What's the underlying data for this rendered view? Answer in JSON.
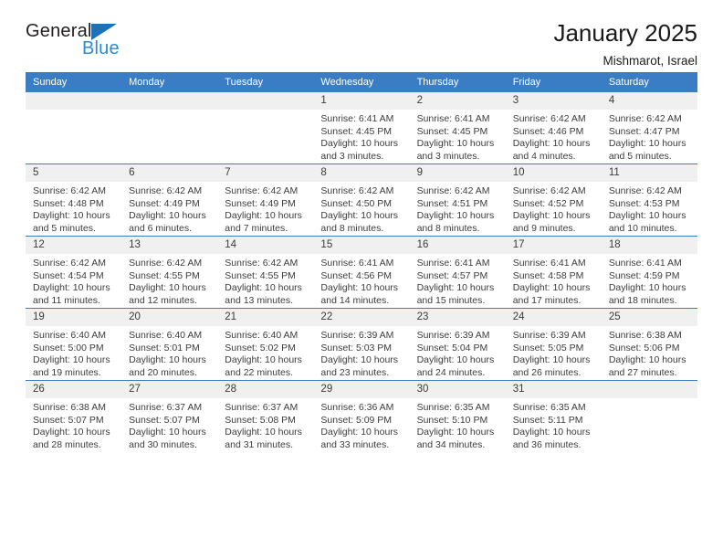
{
  "brand": {
    "name_top": "General",
    "name_bottom": "Blue",
    "accent_color": "#2e8ad4",
    "triangle_color": "#1d71b8"
  },
  "header": {
    "title": "January 2025",
    "subtitle": "Mishmarot, Israel"
  },
  "calendar": {
    "header_bg": "#3b7dc4",
    "daynum_bg": "#f0f0f0",
    "weekdays": [
      "Sunday",
      "Monday",
      "Tuesday",
      "Wednesday",
      "Thursday",
      "Friday",
      "Saturday"
    ],
    "labels": {
      "sunrise": "Sunrise:",
      "sunset": "Sunset:",
      "daylight": "Daylight:"
    },
    "weeks": [
      [
        {
          "day": "",
          "empty": true
        },
        {
          "day": "",
          "empty": true
        },
        {
          "day": "",
          "empty": true
        },
        {
          "day": "1",
          "sunrise": "Sunrise: 6:41 AM",
          "sunset": "Sunset: 4:45 PM",
          "daylight": "Daylight: 10 hours and 3 minutes."
        },
        {
          "day": "2",
          "sunrise": "Sunrise: 6:41 AM",
          "sunset": "Sunset: 4:45 PM",
          "daylight": "Daylight: 10 hours and 3 minutes."
        },
        {
          "day": "3",
          "sunrise": "Sunrise: 6:42 AM",
          "sunset": "Sunset: 4:46 PM",
          "daylight": "Daylight: 10 hours and 4 minutes."
        },
        {
          "day": "4",
          "sunrise": "Sunrise: 6:42 AM",
          "sunset": "Sunset: 4:47 PM",
          "daylight": "Daylight: 10 hours and 5 minutes."
        }
      ],
      [
        {
          "day": "5",
          "sunrise": "Sunrise: 6:42 AM",
          "sunset": "Sunset: 4:48 PM",
          "daylight": "Daylight: 10 hours and 5 minutes."
        },
        {
          "day": "6",
          "sunrise": "Sunrise: 6:42 AM",
          "sunset": "Sunset: 4:49 PM",
          "daylight": "Daylight: 10 hours and 6 minutes."
        },
        {
          "day": "7",
          "sunrise": "Sunrise: 6:42 AM",
          "sunset": "Sunset: 4:49 PM",
          "daylight": "Daylight: 10 hours and 7 minutes."
        },
        {
          "day": "8",
          "sunrise": "Sunrise: 6:42 AM",
          "sunset": "Sunset: 4:50 PM",
          "daylight": "Daylight: 10 hours and 8 minutes."
        },
        {
          "day": "9",
          "sunrise": "Sunrise: 6:42 AM",
          "sunset": "Sunset: 4:51 PM",
          "daylight": "Daylight: 10 hours and 8 minutes."
        },
        {
          "day": "10",
          "sunrise": "Sunrise: 6:42 AM",
          "sunset": "Sunset: 4:52 PM",
          "daylight": "Daylight: 10 hours and 9 minutes."
        },
        {
          "day": "11",
          "sunrise": "Sunrise: 6:42 AM",
          "sunset": "Sunset: 4:53 PM",
          "daylight": "Daylight: 10 hours and 10 minutes."
        }
      ],
      [
        {
          "day": "12",
          "sunrise": "Sunrise: 6:42 AM",
          "sunset": "Sunset: 4:54 PM",
          "daylight": "Daylight: 10 hours and 11 minutes."
        },
        {
          "day": "13",
          "sunrise": "Sunrise: 6:42 AM",
          "sunset": "Sunset: 4:55 PM",
          "daylight": "Daylight: 10 hours and 12 minutes."
        },
        {
          "day": "14",
          "sunrise": "Sunrise: 6:42 AM",
          "sunset": "Sunset: 4:55 PM",
          "daylight": "Daylight: 10 hours and 13 minutes."
        },
        {
          "day": "15",
          "sunrise": "Sunrise: 6:41 AM",
          "sunset": "Sunset: 4:56 PM",
          "daylight": "Daylight: 10 hours and 14 minutes."
        },
        {
          "day": "16",
          "sunrise": "Sunrise: 6:41 AM",
          "sunset": "Sunset: 4:57 PM",
          "daylight": "Daylight: 10 hours and 15 minutes."
        },
        {
          "day": "17",
          "sunrise": "Sunrise: 6:41 AM",
          "sunset": "Sunset: 4:58 PM",
          "daylight": "Daylight: 10 hours and 17 minutes."
        },
        {
          "day": "18",
          "sunrise": "Sunrise: 6:41 AM",
          "sunset": "Sunset: 4:59 PM",
          "daylight": "Daylight: 10 hours and 18 minutes."
        }
      ],
      [
        {
          "day": "19",
          "sunrise": "Sunrise: 6:40 AM",
          "sunset": "Sunset: 5:00 PM",
          "daylight": "Daylight: 10 hours and 19 minutes."
        },
        {
          "day": "20",
          "sunrise": "Sunrise: 6:40 AM",
          "sunset": "Sunset: 5:01 PM",
          "daylight": "Daylight: 10 hours and 20 minutes."
        },
        {
          "day": "21",
          "sunrise": "Sunrise: 6:40 AM",
          "sunset": "Sunset: 5:02 PM",
          "daylight": "Daylight: 10 hours and 22 minutes."
        },
        {
          "day": "22",
          "sunrise": "Sunrise: 6:39 AM",
          "sunset": "Sunset: 5:03 PM",
          "daylight": "Daylight: 10 hours and 23 minutes."
        },
        {
          "day": "23",
          "sunrise": "Sunrise: 6:39 AM",
          "sunset": "Sunset: 5:04 PM",
          "daylight": "Daylight: 10 hours and 24 minutes."
        },
        {
          "day": "24",
          "sunrise": "Sunrise: 6:39 AM",
          "sunset": "Sunset: 5:05 PM",
          "daylight": "Daylight: 10 hours and 26 minutes."
        },
        {
          "day": "25",
          "sunrise": "Sunrise: 6:38 AM",
          "sunset": "Sunset: 5:06 PM",
          "daylight": "Daylight: 10 hours and 27 minutes."
        }
      ],
      [
        {
          "day": "26",
          "sunrise": "Sunrise: 6:38 AM",
          "sunset": "Sunset: 5:07 PM",
          "daylight": "Daylight: 10 hours and 28 minutes."
        },
        {
          "day": "27",
          "sunrise": "Sunrise: 6:37 AM",
          "sunset": "Sunset: 5:07 PM",
          "daylight": "Daylight: 10 hours and 30 minutes."
        },
        {
          "day": "28",
          "sunrise": "Sunrise: 6:37 AM",
          "sunset": "Sunset: 5:08 PM",
          "daylight": "Daylight: 10 hours and 31 minutes."
        },
        {
          "day": "29",
          "sunrise": "Sunrise: 6:36 AM",
          "sunset": "Sunset: 5:09 PM",
          "daylight": "Daylight: 10 hours and 33 minutes."
        },
        {
          "day": "30",
          "sunrise": "Sunrise: 6:35 AM",
          "sunset": "Sunset: 5:10 PM",
          "daylight": "Daylight: 10 hours and 34 minutes."
        },
        {
          "day": "31",
          "sunrise": "Sunrise: 6:35 AM",
          "sunset": "Sunset: 5:11 PM",
          "daylight": "Daylight: 10 hours and 36 minutes."
        },
        {
          "day": "",
          "empty": true
        }
      ]
    ]
  }
}
